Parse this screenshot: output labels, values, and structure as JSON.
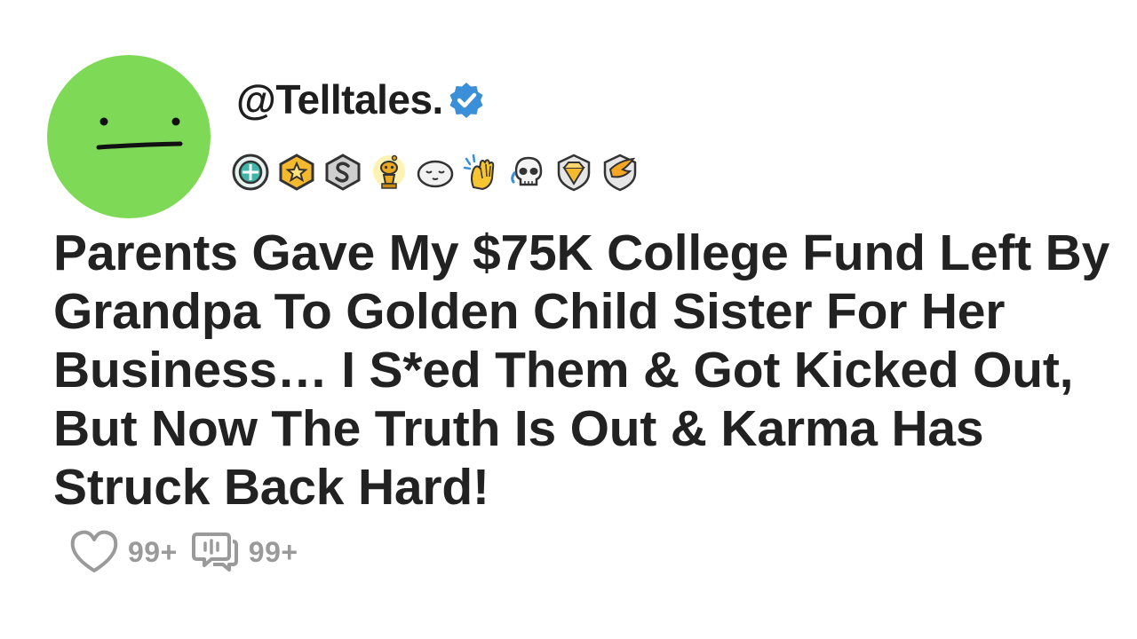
{
  "post": {
    "username": "@Telltales.",
    "verified": true,
    "avatar_color": "#7ed957",
    "badges": [
      "rocket-award-icon",
      "gold-star-award-icon",
      "silver-s-award-icon",
      "gold-snoo-trophy-icon",
      "sleepy-blob-award-icon",
      "clapping-hands-icon",
      "crying-laughing-skull-icon",
      "gold-gem-shield-icon",
      "silver-wing-shield-icon"
    ],
    "title": "Parents Gave My $75K College Fund Left By Grandpa To Golden Child Sister For Her Business… I S*ed Them & Got Kicked Out, But Now The Truth Is Out & Karma Has Struck Back Hard!",
    "likes": "99+",
    "comments": "99+"
  },
  "colors": {
    "text": "#222222",
    "muted": "#9a9a9a",
    "verified_blue": "#3b8fd9"
  }
}
